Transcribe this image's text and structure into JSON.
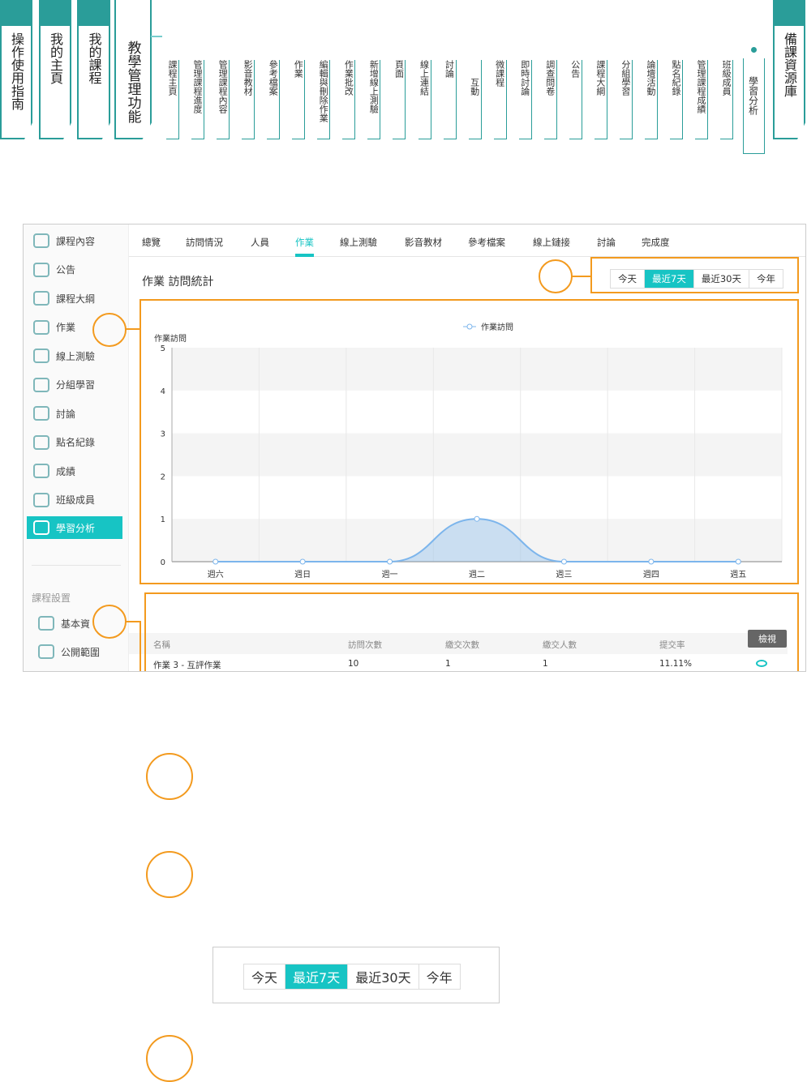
{
  "top_nav": {
    "main_tabs": [
      "操作使用指南",
      "我的主頁",
      "我的課程",
      "教學管理功能"
    ],
    "sub_items": [
      "課程主頁",
      "管理課程進度",
      "管理課程內容",
      "影音教材",
      "參考檔案",
      "作業",
      "編輯與刪除作業",
      "作業批改",
      "新增線上測驗",
      "頁面",
      "線上連結",
      "討論",
      "互動",
      "微課程",
      "即時討論",
      "調查問卷",
      "公告",
      "課程大綱",
      "分組學習",
      "論壇活動",
      "點名紀錄",
      "管理課程成績",
      "班級成員",
      "學習分析"
    ],
    "active_sub": "學習分析",
    "right_tab": "備課資源庫",
    "accent": "#2a9d99"
  },
  "sidebar": {
    "items": [
      "課程內容",
      "公告",
      "課程大綱",
      "作業",
      "線上測驗",
      "分組學習",
      "討論",
      "點名紀錄",
      "成績",
      "班級成員",
      "學習分析"
    ],
    "active": "學習分析",
    "section_title": "課程設置",
    "settings_items": [
      "基本資",
      "公開範圍"
    ]
  },
  "tabs": [
    "總覽",
    "訪問情況",
    "人員",
    "作業",
    "線上測驗",
    "影音教材",
    "參考檔案",
    "線上鏈接",
    "討論",
    "完成度"
  ],
  "active_tab": "作業",
  "panel_title": "作業 訪問統計",
  "range_buttons": [
    "今天",
    "最近7天",
    "最近30天",
    "今年"
  ],
  "range_selected": "最近7天",
  "chart_data": {
    "type": "area",
    "ylabel": "作業訪問",
    "legend": "作業訪問",
    "legend_position": "top",
    "categories": [
      "週六",
      "週日",
      "週一",
      "週二",
      "週三",
      "週四",
      "週五"
    ],
    "series": [
      {
        "name": "作業訪問",
        "values": [
          0,
          0,
          0,
          1,
          0,
          0,
          0
        ]
      }
    ],
    "ylim": [
      0,
      5
    ],
    "yticks": [
      0,
      1,
      2,
      3,
      4,
      5
    ],
    "grid": true,
    "color": "#7cb5ec"
  },
  "table": {
    "headers": [
      "名稱",
      "訪問次數",
      "繳交次數",
      "繳交人數",
      "提交率"
    ],
    "rows": [
      [
        "作業 3 - 互評作業",
        "10",
        "1",
        "1",
        "11.11%"
      ]
    ],
    "tooltip": "檢視"
  },
  "highlight_color": "#f39a1e"
}
